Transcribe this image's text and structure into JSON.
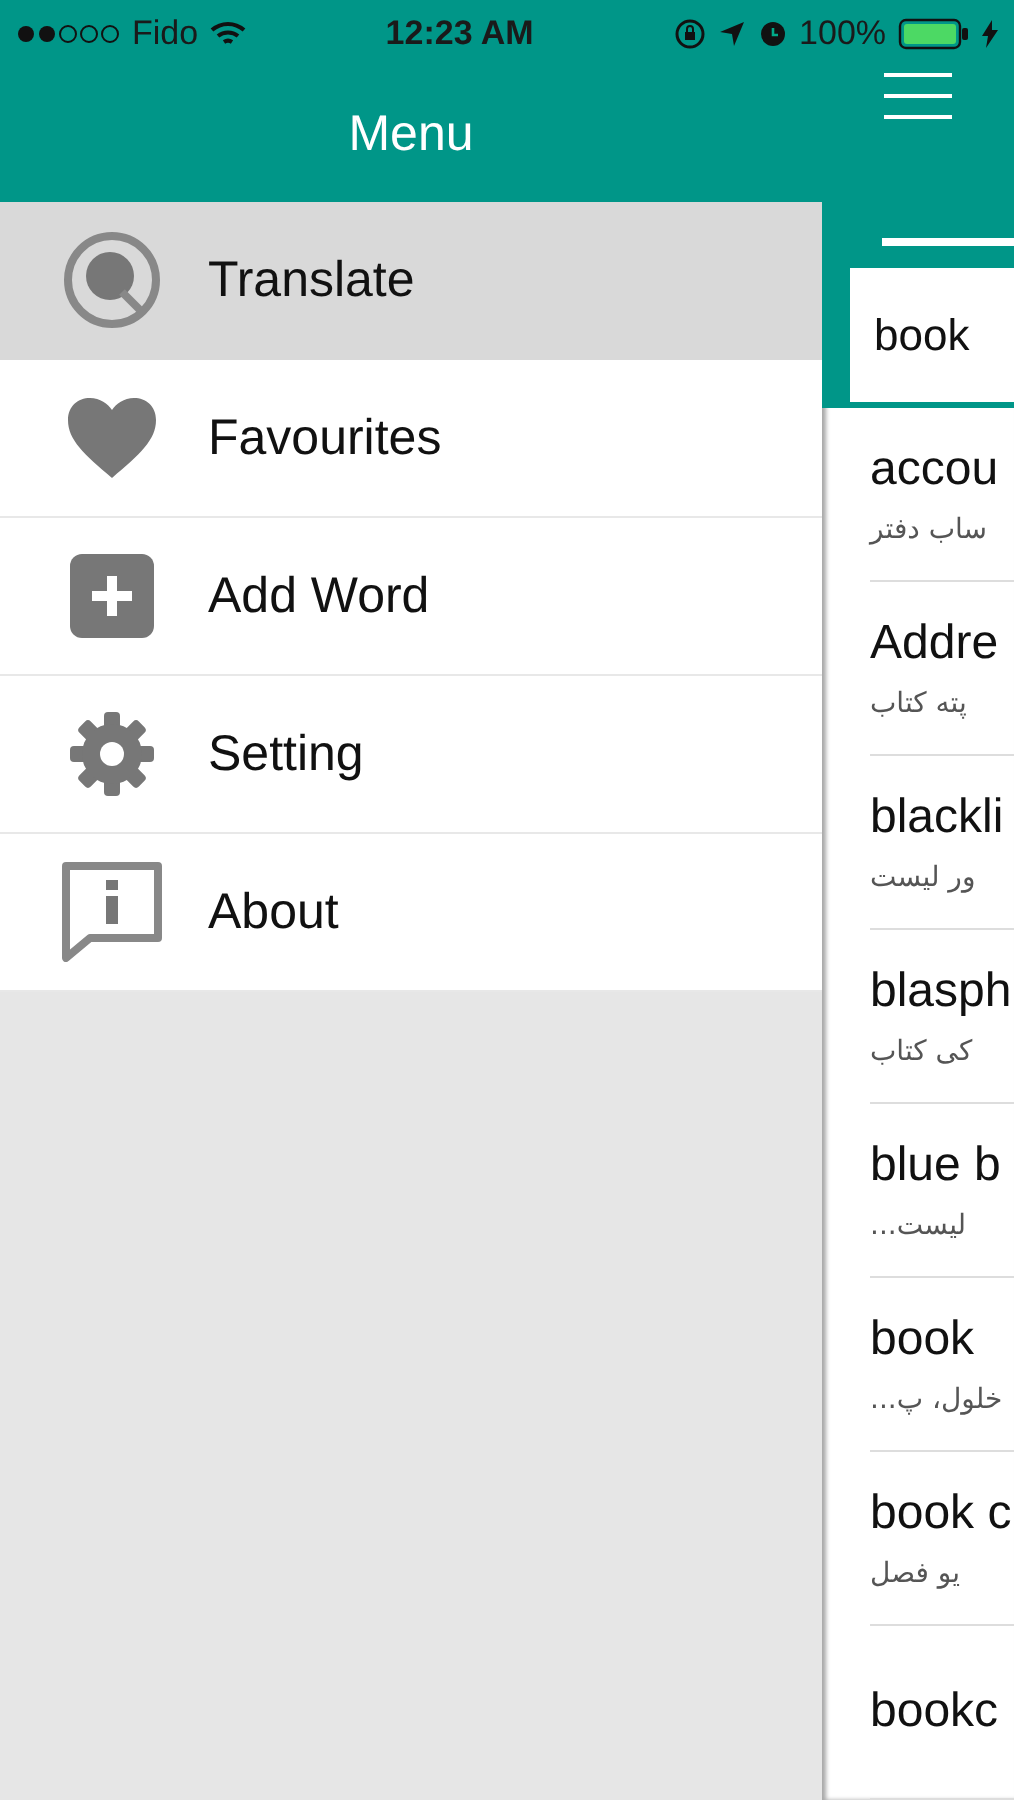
{
  "status_bar": {
    "carrier": "Fido",
    "time": "12:23 AM",
    "battery": "100%"
  },
  "menu": {
    "title": "Menu",
    "items": [
      {
        "label": "Translate",
        "kind": "search",
        "selected": true
      },
      {
        "label": "Favourites",
        "kind": "heart",
        "selected": false
      },
      {
        "label": "Add Word",
        "kind": "add",
        "selected": false
      },
      {
        "label": "Setting",
        "kind": "settings",
        "selected": false
      },
      {
        "label": "About",
        "kind": "info",
        "selected": false
      }
    ]
  },
  "translate_panel": {
    "search": {
      "value": "book"
    },
    "results": [
      {
        "word": "accou",
        "meaning": "ساب دفتر"
      },
      {
        "word": "Addre",
        "meaning": "پته کتاب"
      },
      {
        "word": "blackli",
        "meaning": "ور لیست"
      },
      {
        "word": "blasph",
        "meaning": "کی کتاب"
      },
      {
        "word": "blue b",
        "meaning": "لیست..."
      },
      {
        "word": "book",
        "meaning": "خلول، پ..."
      },
      {
        "word": "book c",
        "meaning": "یو فصل"
      },
      {
        "word": "bookc"
      }
    ]
  }
}
